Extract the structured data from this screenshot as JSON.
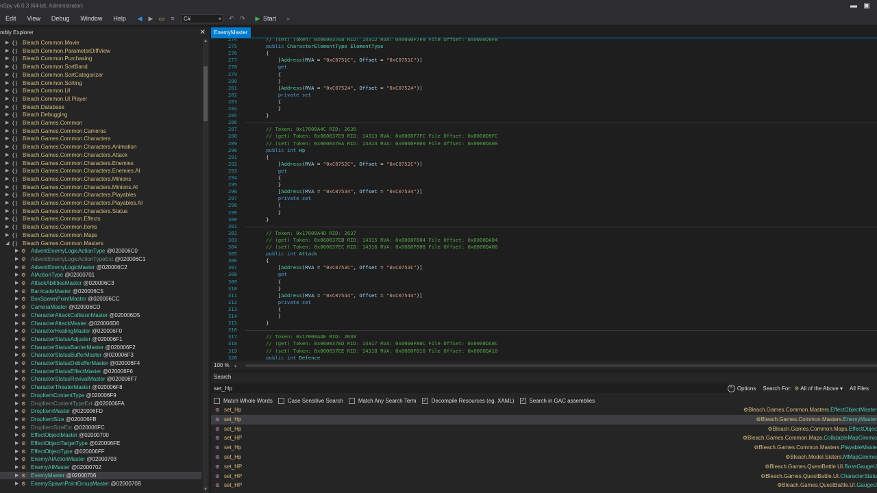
{
  "window": {
    "title": "nSpy v6.0.3 (64-bit, Administrator)"
  },
  "menu": {
    "items": [
      "Edit",
      "View",
      "Debug",
      "Window",
      "Help"
    ],
    "language": "C#",
    "start_label": "Start"
  },
  "explorer": {
    "title": "mbly Explorer",
    "namespaces": [
      "Bleach.Common.Movie",
      "Bleach.Common.ParameterDiffView",
      "Bleach.Common.Purchasing",
      "Bleach.Common.SortBand",
      "Bleach.Common.SortCategorizer",
      "Bleach.Common.Sorting",
      "Bleach.Common.UI",
      "Bleach.Common.UI.Player",
      "Bleach.Database",
      "Bleach.Debugging",
      "Bleach.Games.Common",
      "Bleach.Games.Common.Cameras",
      "Bleach.Games.Common.Characters",
      "Bleach.Games.Common.Characters.Animation",
      "Bleach.Games.Common.Characters.Attack",
      "Bleach.Games.Common.Characters.Enemies",
      "Bleach.Games.Common.Characters.Enemies.AI",
      "Bleach.Games.Common.Characters.Minions",
      "Bleach.Games.Common.Characters.Minions.AI",
      "Bleach.Games.Common.Characters.Playables",
      "Bleach.Games.Common.Characters.Playables.AI",
      "Bleach.Games.Common.Characters.Status",
      "Bleach.Games.Common.Effects",
      "Bleach.Games.Common.Items",
      "Bleach.Games.Common.Maps",
      "Bleach.Games.Common.Masters"
    ],
    "classes": [
      {
        "name": "AdventEnemyLogicActionType",
        "token": "@020006C0",
        "dim": false
      },
      {
        "name": "AdventEnemyLogicActionTypeExt",
        "token": "@020006C1",
        "dim": true
      },
      {
        "name": "AdventEnemyLogicMaster",
        "token": "@020006C2",
        "dim": false
      },
      {
        "name": "AIActionType",
        "token": "@02000701",
        "dim": false
      },
      {
        "name": "AttackAbilitiesMaster",
        "token": "@020006C3",
        "dim": false
      },
      {
        "name": "BarricadeMaster",
        "token": "@020006C5",
        "dim": false
      },
      {
        "name": "BoxSpawnPointMaster",
        "token": "@020006CC",
        "dim": false
      },
      {
        "name": "CameraMaster",
        "token": "@020006CD",
        "dim": false
      },
      {
        "name": "CharacterAttackCollisionMaster",
        "token": "@020006D5",
        "dim": false
      },
      {
        "name": "CharacterAttackMaster",
        "token": "@020006D6",
        "dim": false
      },
      {
        "name": "CharacterHealingMaster",
        "token": "@020006F0",
        "dim": false
      },
      {
        "name": "CharacterStatusAdjuster",
        "token": "@020006F1",
        "dim": false
      },
      {
        "name": "CharacterStatusBarrierMaster",
        "token": "@020006F2",
        "dim": false
      },
      {
        "name": "CharacterStatusBufferMaster",
        "token": "@020006F3",
        "dim": false
      },
      {
        "name": "CharacterStatusDebufferMaster",
        "token": "@020006F4",
        "dim": false
      },
      {
        "name": "CharacterStatusEffectMaster",
        "token": "@020006F6",
        "dim": false
      },
      {
        "name": "CharacterStatusRevivalMaster",
        "token": "@020006F7",
        "dim": false
      },
      {
        "name": "CharacterTheaterMaster",
        "token": "@020006F8",
        "dim": false
      },
      {
        "name": "DropItemContentType",
        "token": "@020006F9",
        "dim": false
      },
      {
        "name": "DropItemContentTypeExt",
        "token": "@020006FA",
        "dim": true
      },
      {
        "name": "DropItemMaster",
        "token": "@020006FD",
        "dim": false
      },
      {
        "name": "DropItemSize",
        "token": "@020006FB",
        "dim": false
      },
      {
        "name": "DropItemSizeExt",
        "token": "@020006FC",
        "dim": true
      },
      {
        "name": "EffectObjectMaster",
        "token": "@02000700",
        "dim": false
      },
      {
        "name": "EffectObjectTargetType",
        "token": "@020006FE",
        "dim": false
      },
      {
        "name": "EffectObjectType",
        "token": "@020006FF",
        "dim": false
      },
      {
        "name": "EnemyAIActionMaster",
        "token": "@02000703",
        "dim": false
      },
      {
        "name": "EnemyAIMaster",
        "token": "@02000702",
        "dim": false
      },
      {
        "name": "EnemyMaster",
        "token": "@02000706",
        "dim": false
      },
      {
        "name": "EnemySpawnPointGroupMaster",
        "token": "@0200070B",
        "dim": false
      }
    ],
    "selected_class": "EnemyMaster"
  },
  "editor": {
    "tab": "EnemyMaster",
    "zoom": "100 %",
    "lines": [
      {
        "n": "274",
        "t": "        // (set) Token: 0x060037E8 RID: 14312 RVA: 0x0000F7F8 File Offset: 0x0000D9F8"
      },
      {
        "n": "275",
        "t": "        public CharacterElementType ElementType"
      },
      {
        "n": "276",
        "t": "        {"
      },
      {
        "n": "277",
        "t": "            [Address(RVA = \"0xC0751C\", Offset = \"0xC0751C\")]"
      },
      {
        "n": "278",
        "t": "            get"
      },
      {
        "n": "279",
        "t": "            {"
      },
      {
        "n": "280",
        "t": "            }"
      },
      {
        "n": "281",
        "t": "            [Address(RVA = \"0xC07524\", Offset = \"0xC07524\")]"
      },
      {
        "n": "282",
        "t": "            private set"
      },
      {
        "n": "283",
        "t": "            {"
      },
      {
        "n": "284",
        "t": "            }"
      },
      {
        "n": "285",
        "t": "        }"
      },
      {
        "n": "286",
        "t": ""
      },
      {
        "n": "287",
        "t": "        // Token: 0x17000A4C RID: 2636"
      },
      {
        "n": "288",
        "t": "        // (get) Token: 0x060037E9 RID: 14313 RVA: 0x0000F7FC File Offset: 0x0000D9FC"
      },
      {
        "n": "289",
        "t": "        // (set) Token: 0x060037EA RID: 14314 RVA: 0x0000F800 File Offset: 0x0000DA00"
      },
      {
        "n": "290",
        "t": "        public int Hp"
      },
      {
        "n": "291",
        "t": "        {"
      },
      {
        "n": "292",
        "t": "            [Address(RVA = \"0xC0752C\", Offset = \"0xC0752C\")]"
      },
      {
        "n": "293",
        "t": "            get"
      },
      {
        "n": "294",
        "t": "            {"
      },
      {
        "n": "295",
        "t": "            }"
      },
      {
        "n": "296",
        "t": "            [Address(RVA = \"0xC07534\", Offset = \"0xC07534\")]"
      },
      {
        "n": "297",
        "t": "            private set"
      },
      {
        "n": "298",
        "t": "            {"
      },
      {
        "n": "299",
        "t": "            }"
      },
      {
        "n": "300",
        "t": "        }"
      },
      {
        "n": "301",
        "t": ""
      },
      {
        "n": "302",
        "t": "        // Token: 0x17000A4D RID: 2637"
      },
      {
        "n": "303",
        "t": "        // (get) Token: 0x060037EB RID: 14315 RVA: 0x0000F804 File Offset: 0x0000DA04"
      },
      {
        "n": "304",
        "t": "        // (set) Token: 0x060037EC RID: 14316 RVA: 0x0000F808 File Offset: 0x0000DA08"
      },
      {
        "n": "305",
        "t": "        public int Attack"
      },
      {
        "n": "306",
        "t": "        {"
      },
      {
        "n": "307",
        "t": "            [Address(RVA = \"0xC0753C\", Offset = \"0xC0753C\")]"
      },
      {
        "n": "308",
        "t": "            get"
      },
      {
        "n": "309",
        "t": "            {"
      },
      {
        "n": "310",
        "t": "            }"
      },
      {
        "n": "311",
        "t": "            [Address(RVA = \"0xC07544\", Offset = \"0xC07544\")]"
      },
      {
        "n": "312",
        "t": "            private set"
      },
      {
        "n": "313",
        "t": "            {"
      },
      {
        "n": "314",
        "t": "            }"
      },
      {
        "n": "315",
        "t": "        }"
      },
      {
        "n": "316",
        "t": ""
      },
      {
        "n": "317",
        "t": "        // Token: 0x17000A4E RID: 2638"
      },
      {
        "n": "318",
        "t": "        // (get) Token: 0x060037ED RID: 14317 RVA: 0x0000F80C File Offset: 0x0000DA0C"
      },
      {
        "n": "319",
        "t": "        // (set) Token: 0x060037EE RID: 14318 RVA: 0x0000F810 File Offset: 0x0000DA10"
      },
      {
        "n": "320",
        "t": "        public int Defence"
      }
    ]
  },
  "search": {
    "title": "Search",
    "query": "set_Hp",
    "options_label": "Options",
    "search_for_label": "Search For:",
    "search_for_value": "All of the Above",
    "scope_value": "All Files",
    "checks": [
      {
        "label": "Match Whole Words",
        "checked": false
      },
      {
        "label": "Case Sensitive Search",
        "checked": false
      },
      {
        "label": "Match Any Search Term",
        "checked": false
      },
      {
        "label": "Decompile Resources (eg. XAML)",
        "checked": true
      },
      {
        "label": "Search in GAC assemblies",
        "checked": true
      }
    ],
    "results": [
      {
        "name": "set_Hp",
        "ns": "Bleach.Games.Common.Masters.",
        "cls": "EffectObjectMaster"
      },
      {
        "name": "set_Hp",
        "ns": "Bleach.Games.Common.Masters.",
        "cls": "EnemyMaster"
      },
      {
        "name": "set_Hp",
        "ns": "Bleach.Games.Common.Maps.",
        "cls": "EffectObjec"
      },
      {
        "name": "set_HP",
        "ns": "Bleach.Games.Common.Maps.",
        "cls": "CollidableMapGimmic"
      },
      {
        "name": "set_Hp",
        "ns": "Bleach.Games.Common.Masters.",
        "cls": "PlayableMaste"
      },
      {
        "name": "set_Hp",
        "ns": "Bleach.Model.Sisters.",
        "cls": "MMapGimmic"
      },
      {
        "name": "set_HP",
        "ns": "Bleach.Games.QuestBattle.UI.",
        "cls": "BossGaugeU"
      },
      {
        "name": "set_HP",
        "ns": "Bleach.Games.QuestBattle.UI.",
        "cls": "CharacterStatu"
      },
      {
        "name": "set_HP",
        "ns": "Bleach.Games.QuestBattle.UI.",
        "cls": "GaugeU"
      }
    ],
    "selected_result": 1
  }
}
